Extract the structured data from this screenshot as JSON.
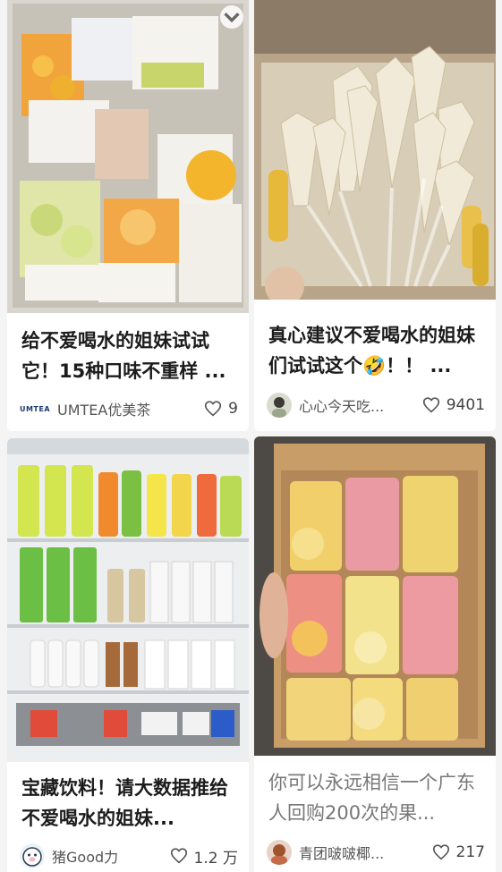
{
  "feed": {
    "cards": [
      {
        "title": "给不爱喝水的姐妹试试它！15种口味不重样 ...",
        "author": "UMTEA优美茶",
        "likes": "9",
        "avatar_text": "UMTEA"
      },
      {
        "title": "真心建议不爱喝水的姐妹们试试这个🤣！！ ...",
        "author": "心心今天吃...",
        "likes": "9401"
      },
      {
        "title": "宝藏饮料！请大数据推给不爱喝水的姐妹...",
        "author": "猪Good力",
        "likes": "1.2 万"
      },
      {
        "title": "你可以永远相信一个广东人回购200次的果...",
        "author": "青团啵啵椰...",
        "likes": "217"
      }
    ]
  },
  "colors": {
    "background": "#f4f4f4",
    "card": "#ffffff",
    "title": "#1c1c1c",
    "muted": "#777777",
    "like_icon": "#555555"
  },
  "icons": {
    "like": "heart-icon",
    "save": "chevron-down-icon"
  }
}
